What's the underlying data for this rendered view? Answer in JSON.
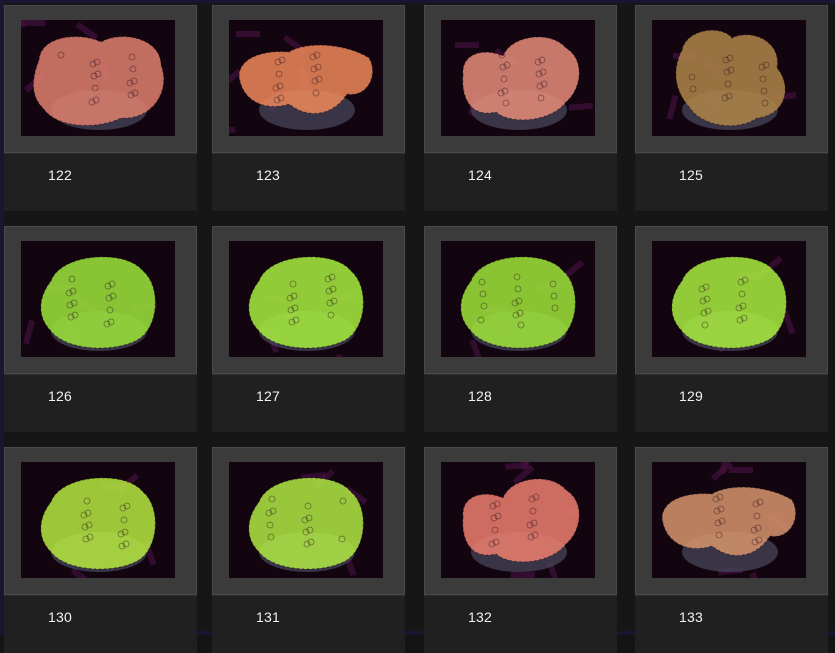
{
  "gallery": {
    "items": [
      {
        "label": "122",
        "coral_color": "#e0806f",
        "shape": "blob-wide"
      },
      {
        "label": "123",
        "coral_color": "#f0895c",
        "shape": "blob-long"
      },
      {
        "label": "124",
        "coral_color": "#e88d7a",
        "shape": "blob-lobed"
      },
      {
        "label": "125",
        "coral_color": "#b0864a",
        "shape": "blob-tall"
      },
      {
        "label": "126",
        "coral_color": "#9ee63a",
        "shape": "round"
      },
      {
        "label": "127",
        "coral_color": "#a8ee3e",
        "shape": "round"
      },
      {
        "label": "128",
        "coral_color": "#a0e63a",
        "shape": "round"
      },
      {
        "label": "129",
        "coral_color": "#aaee40",
        "shape": "round"
      },
      {
        "label": "130",
        "coral_color": "#b6ea40",
        "shape": "round"
      },
      {
        "label": "131",
        "coral_color": "#b2ea44",
        "shape": "round"
      },
      {
        "label": "132",
        "coral_color": "#ef7f6e",
        "shape": "blob-lobed"
      },
      {
        "label": "133",
        "coral_color": "#d8956c",
        "shape": "blob-long"
      }
    ]
  },
  "colors": {
    "card_frame": "#3b3b3b",
    "caption_bg": "#202020",
    "page_bg": "#161616",
    "label_text": "#f2f2f2"
  }
}
